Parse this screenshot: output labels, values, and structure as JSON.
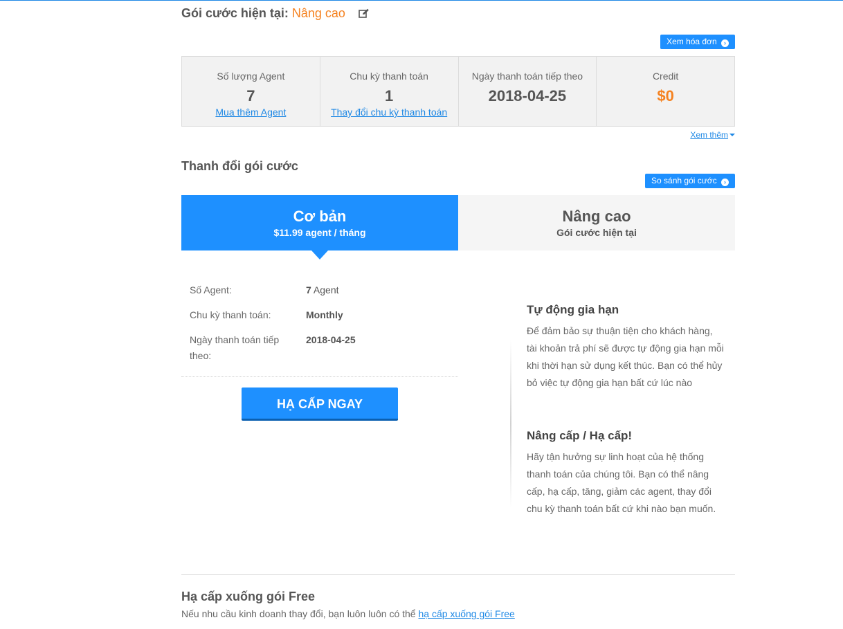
{
  "header": {
    "current_plan_label": "Gói cước hiện tại:",
    "current_plan_name": "Nâng cao",
    "view_invoice": "Xem hóa đơn"
  },
  "stats": [
    {
      "label": "Số lượng Agent",
      "value": "7",
      "link": "Mua thêm Agent"
    },
    {
      "label": "Chu kỳ thanh toán",
      "value": "1",
      "link": "Thay đổi chu kỳ thanh toán"
    },
    {
      "label": "Ngày thanh toán tiếp theo",
      "value": "2018-04-25"
    },
    {
      "label": "Credit",
      "value": "$0"
    }
  ],
  "see_more": "Xem thêm",
  "change_plan": {
    "title": "Thanh đổi gói cước",
    "compare": "So sánh gói cước",
    "tabs": [
      {
        "name": "Cơ bản",
        "sub": "$11.99 agent / tháng"
      },
      {
        "name": "Nâng cao",
        "sub": "Gói cước hiện tại"
      }
    ]
  },
  "details": [
    {
      "label": "Số Agent:",
      "value_bold": "7",
      "value_rest": " Agent"
    },
    {
      "label": "Chu kỳ thanh toán:",
      "value_bold": "Monthly",
      "value_rest": ""
    },
    {
      "label": "Ngày thanh toán tiếp theo:",
      "value_bold": "2018-04-25",
      "value_rest": ""
    }
  ],
  "downgrade_button": "HẠ CẤP NGAY",
  "info": [
    {
      "title": "Tự động gia hạn",
      "text": "Để đảm bảo sự thuận tiện cho khách hàng, tài khoản trả phí sẽ được tự động gia hạn mỗi khi thời hạn sử dụng kết thúc. Bạn có thể hủy bỏ việc tự động gia hạn bất cứ lúc nào"
    },
    {
      "title": "Nâng cấp / Hạ cấp!",
      "text": "Hãy tận hưởng sự linh hoạt của hệ thống thanh toán của chúng tôi. Bạn có thể nâng cấp, hạ cấp, tăng, giảm các agent, thay đổi chu kỳ thanh toán bất cứ khi nào bạn muốn."
    }
  ],
  "free": {
    "title": "Hạ cấp xuống gói Free",
    "text": "Nếu nhu cầu kinh doanh thay đổi, bạn luôn luôn có thể ",
    "link": "hạ cấp xuống gói Free"
  },
  "colors": {
    "accent": "#1e90ff",
    "orange": "#f58220"
  }
}
